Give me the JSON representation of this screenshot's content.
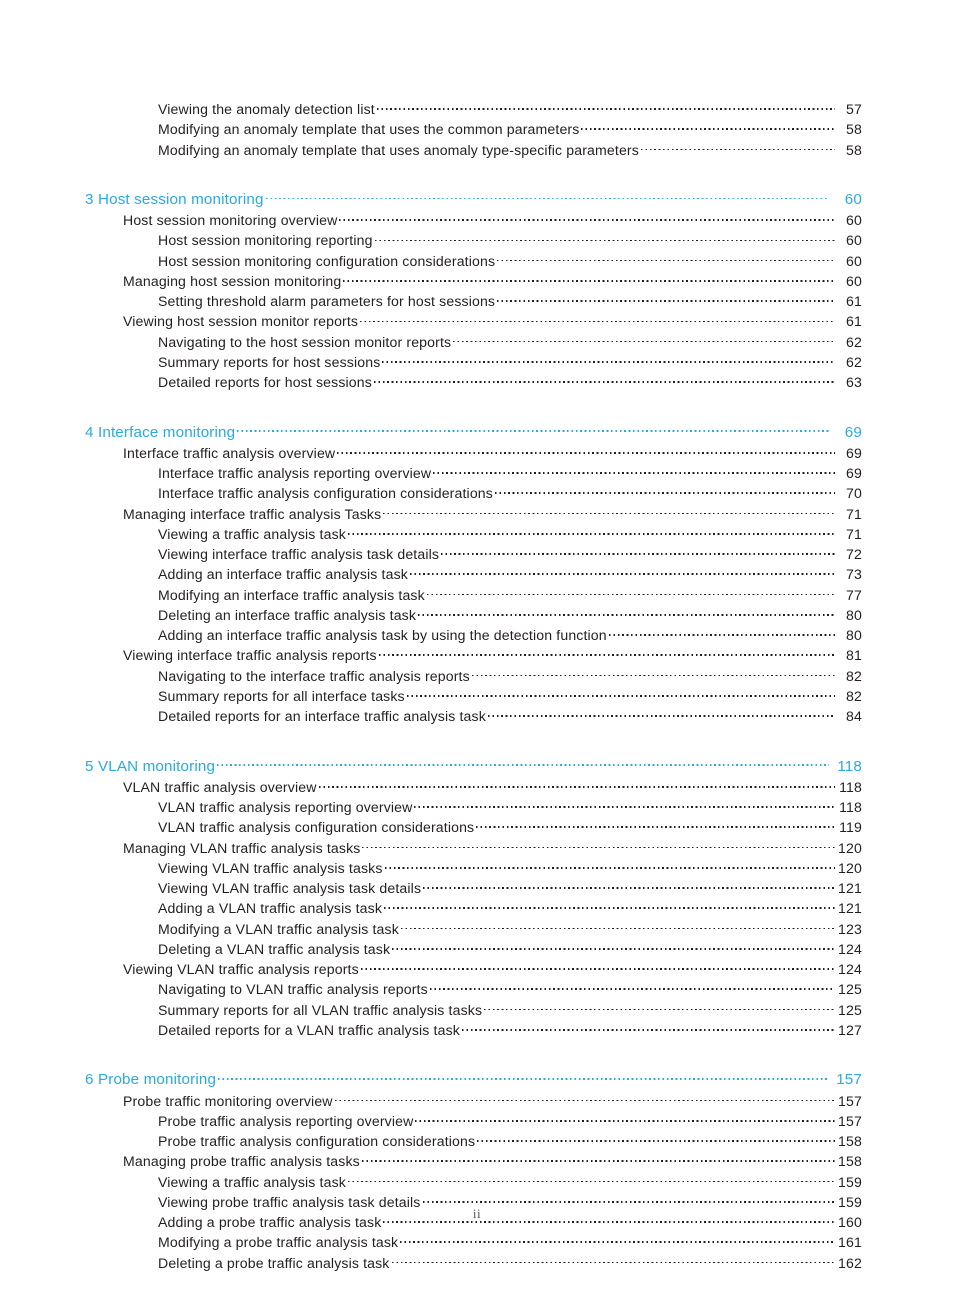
{
  "document": {
    "folio": "ii"
  },
  "toc": {
    "entries": [
      {
        "level": 3,
        "label": "Viewing the anomaly detection list",
        "page": "57"
      },
      {
        "level": 3,
        "label": "Modifying an anomaly template that uses the common parameters",
        "page": "58"
      },
      {
        "level": 3,
        "label": "Modifying an anomaly template that uses anomaly type-specific parameters",
        "page": "58"
      },
      {
        "level": 1,
        "label": "3 Host session monitoring",
        "page": "60"
      },
      {
        "level": 2,
        "label": "Host session monitoring overview",
        "page": "60"
      },
      {
        "level": 3,
        "label": "Host session monitoring reporting",
        "page": "60"
      },
      {
        "level": 3,
        "label": "Host session monitoring configuration considerations",
        "page": "60"
      },
      {
        "level": 2,
        "label": "Managing host session monitoring",
        "page": "60"
      },
      {
        "level": 3,
        "label": "Setting threshold alarm parameters for host sessions",
        "page": "61"
      },
      {
        "level": 2,
        "label": "Viewing host session monitor reports",
        "page": "61"
      },
      {
        "level": 3,
        "label": "Navigating to the host session monitor reports",
        "page": "62"
      },
      {
        "level": 3,
        "label": "Summary reports for host sessions",
        "page": "62"
      },
      {
        "level": 3,
        "label": "Detailed reports for host sessions",
        "page": "63"
      },
      {
        "level": 1,
        "label": "4 Interface monitoring",
        "page": "69"
      },
      {
        "level": 2,
        "label": "Interface traffic analysis overview",
        "page": "69"
      },
      {
        "level": 3,
        "label": "Interface traffic analysis reporting overview",
        "page": "69"
      },
      {
        "level": 3,
        "label": "Interface traffic analysis configuration considerations",
        "page": "70"
      },
      {
        "level": 2,
        "label": "Managing interface traffic analysis Tasks",
        "page": "71"
      },
      {
        "level": 3,
        "label": "Viewing a traffic analysis task",
        "page": "71"
      },
      {
        "level": 3,
        "label": "Viewing interface traffic analysis task details",
        "page": "72"
      },
      {
        "level": 3,
        "label": "Adding an interface traffic analysis task",
        "page": "73"
      },
      {
        "level": 3,
        "label": "Modifying an interface traffic analysis task",
        "page": "77"
      },
      {
        "level": 3,
        "label": "Deleting an interface traffic analysis task",
        "page": "80"
      },
      {
        "level": 3,
        "label": "Adding an interface traffic analysis task by using the detection function",
        "page": "80"
      },
      {
        "level": 2,
        "label": "Viewing interface traffic analysis reports",
        "page": "81"
      },
      {
        "level": 3,
        "label": "Navigating to the interface traffic analysis reports",
        "page": "82"
      },
      {
        "level": 3,
        "label": "Summary reports for all interface tasks",
        "page": "82"
      },
      {
        "level": 3,
        "label": "Detailed reports for an interface traffic analysis task",
        "page": "84"
      },
      {
        "level": 1,
        "label": "5 VLAN monitoring",
        "page": "118"
      },
      {
        "level": 2,
        "label": "VLAN traffic analysis overview",
        "page": "118"
      },
      {
        "level": 3,
        "label": "VLAN traffic analysis reporting overview",
        "page": "118"
      },
      {
        "level": 3,
        "label": "VLAN traffic analysis configuration considerations",
        "page": "119"
      },
      {
        "level": 2,
        "label": "Managing VLAN traffic analysis tasks",
        "page": "120"
      },
      {
        "level": 3,
        "label": "Viewing VLAN traffic analysis tasks",
        "page": "120"
      },
      {
        "level": 3,
        "label": "Viewing VLAN traffic analysis task details",
        "page": "121"
      },
      {
        "level": 3,
        "label": "Adding a VLAN traffic analysis task",
        "page": "121"
      },
      {
        "level": 3,
        "label": "Modifying a VLAN traffic analysis task",
        "page": "123"
      },
      {
        "level": 3,
        "label": "Deleting a VLAN traffic analysis task",
        "page": "124"
      },
      {
        "level": 2,
        "label": "Viewing VLAN traffic analysis reports",
        "page": "124"
      },
      {
        "level": 3,
        "label": "Navigating to VLAN traffic analysis reports",
        "page": "125"
      },
      {
        "level": 3,
        "label": "Summary reports for all VLAN traffic analysis tasks",
        "page": "125"
      },
      {
        "level": 3,
        "label": "Detailed reports for a VLAN traffic analysis task",
        "page": "127"
      },
      {
        "level": 1,
        "label": "6 Probe monitoring",
        "page": "157"
      },
      {
        "level": 2,
        "label": "Probe traffic monitoring overview",
        "page": "157"
      },
      {
        "level": 3,
        "label": "Probe traffic analysis reporting overview",
        "page": "157"
      },
      {
        "level": 3,
        "label": "Probe traffic analysis configuration considerations",
        "page": "158"
      },
      {
        "level": 2,
        "label": "Managing probe traffic analysis tasks",
        "page": "158"
      },
      {
        "level": 3,
        "label": "Viewing a traffic analysis task",
        "page": "159"
      },
      {
        "level": 3,
        "label": "Viewing probe traffic analysis task details",
        "page": "159"
      },
      {
        "level": 3,
        "label": "Adding a probe traffic analysis task",
        "page": "160"
      },
      {
        "level": 3,
        "label": "Modifying a probe traffic analysis task",
        "page": "161"
      },
      {
        "level": 3,
        "label": "Deleting a probe traffic analysis task",
        "page": "162"
      }
    ]
  },
  "colors": {
    "chapter_blue": "#29aae1",
    "body_text": "#231f20",
    "folio_gray": "#58595b"
  }
}
